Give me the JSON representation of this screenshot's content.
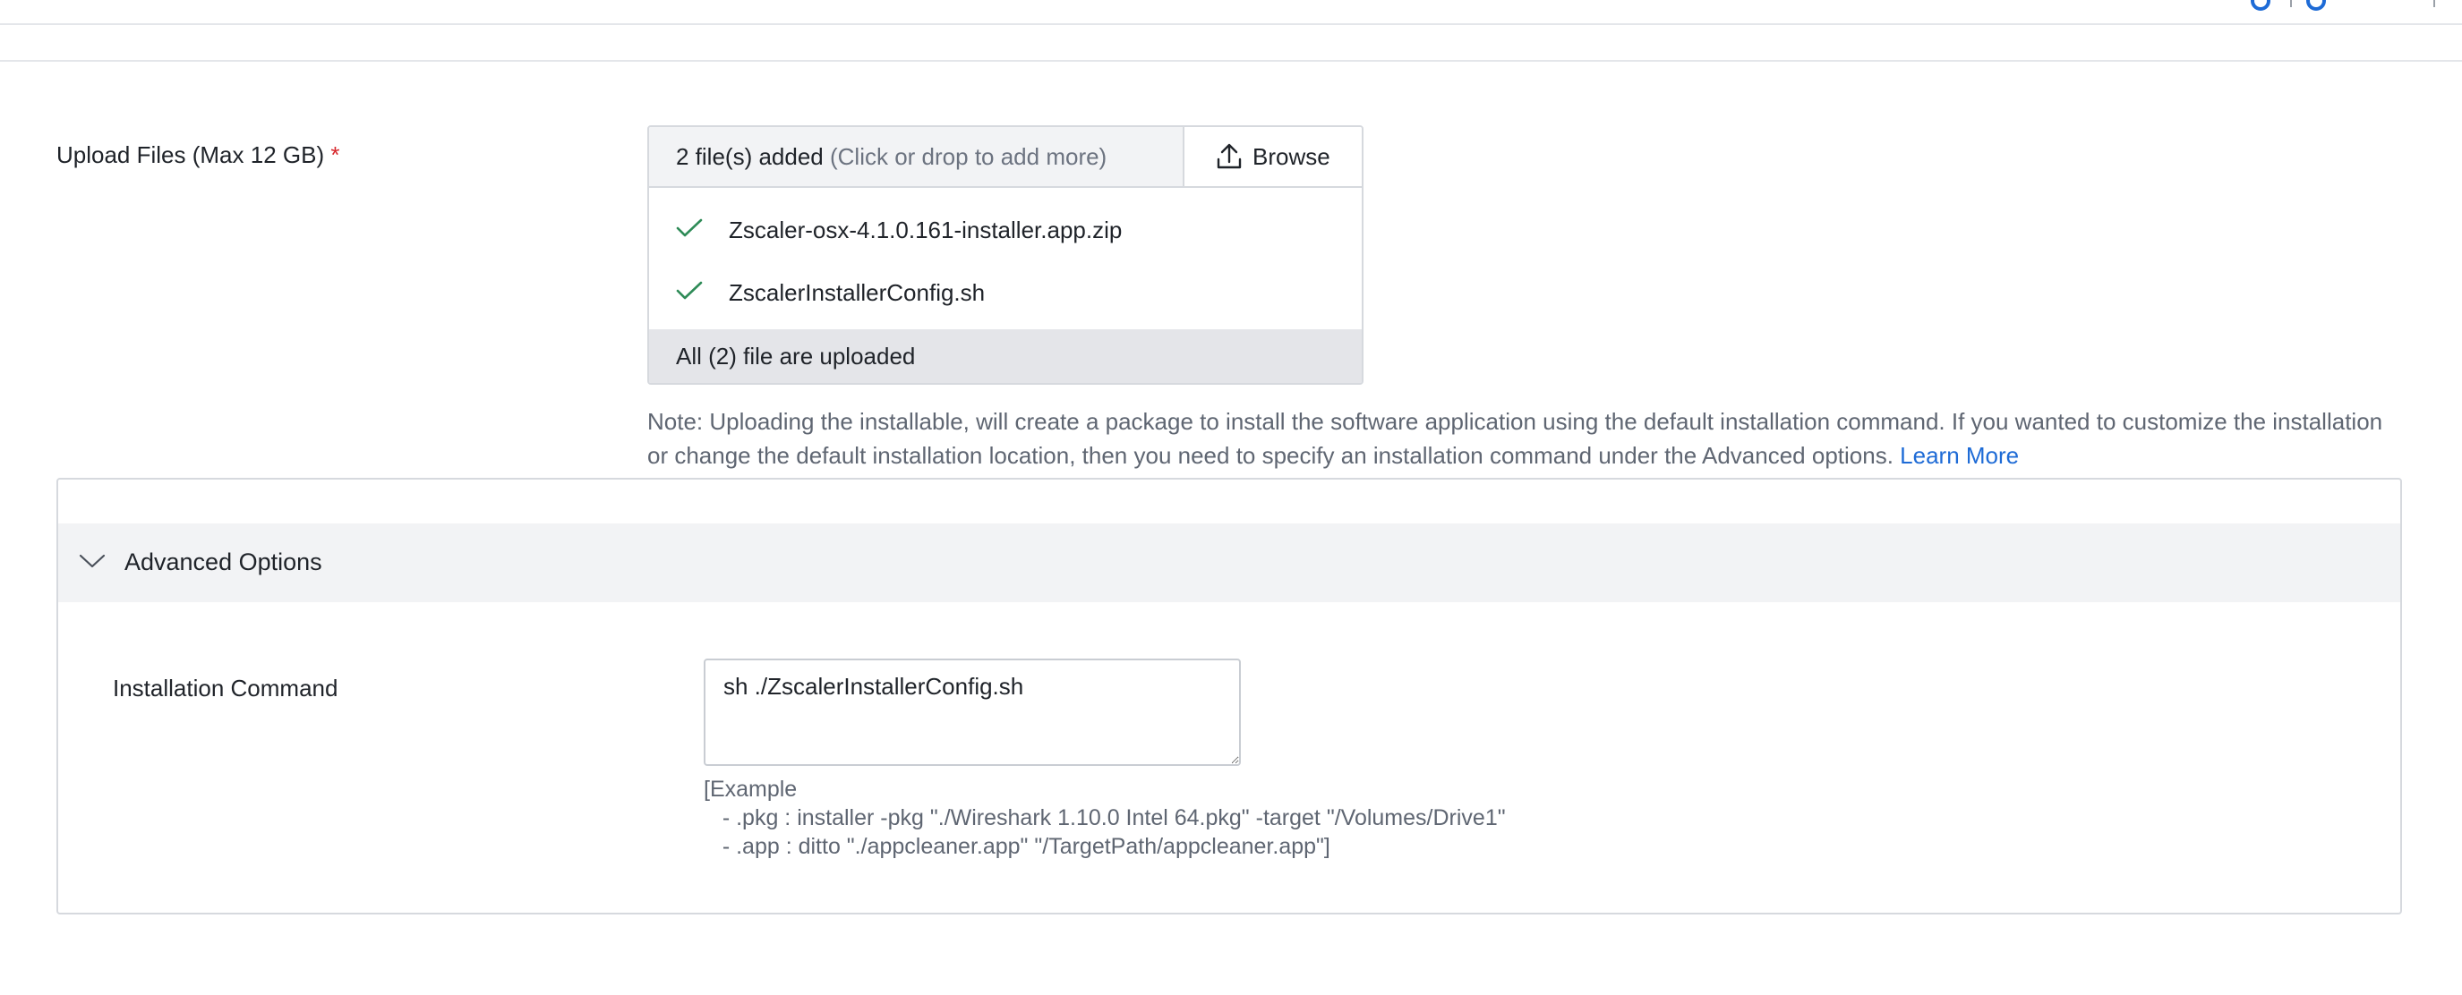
{
  "upload": {
    "label": "Upload Files (Max 12 GB)",
    "required_marker": "*",
    "status_count": "2 file(s) added",
    "status_hint": "(Click or drop to add more)",
    "browse_label": "Browse",
    "files": [
      {
        "name": "Zscaler-osx-4.1.0.161-installer.app.zip",
        "icon": "check-icon"
      },
      {
        "name": "ZscalerInstallerConfig.sh",
        "icon": "check-icon"
      }
    ],
    "footer_status": "All (2) file are uploaded",
    "note": "Note: Uploading the installable, will create a package to install the software application using the default installation command. If you wanted to customize the installation or change the default installation location, then you need to specify an installation command under the Advanced options.",
    "learn_more": "Learn More"
  },
  "advanced": {
    "title": "Advanced Options",
    "expanded": true,
    "command_label": "Installation Command",
    "command_value": "sh ./ZscalerInstallerConfig.sh",
    "example_title": "[Example",
    "example_lines": [
      "   - .pkg : installer -pkg \"./Wireshark 1.10.0 Intel 64.pkg\" -target \"/Volumes/Drive1\"",
      "   - .app : ditto \"./appcleaner.app\" \"/TargetPath/appcleaner.app\"]"
    ]
  },
  "colors": {
    "accent": "#1e6bd6",
    "required": "#d7262b",
    "success": "#2e8b57",
    "muted_text": "#5f6672",
    "header_bg": "#f2f3f5"
  }
}
